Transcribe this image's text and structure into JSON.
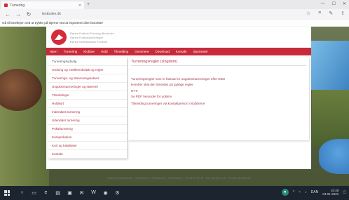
{
  "browser": {
    "tab_title": "Turnering",
    "tab_close": "✕",
    "new_tab": "+",
    "window_controls": [
      "—",
      "☐",
      "✕"
    ],
    "url": "testbulen.dk",
    "infobar_text": "Gå til fanelinjen ved at trykke på stjerne ved at importere dine favoritter"
  },
  "site": {
    "header_lines": [
      "Rønne Fodbold Forening Bornholm",
      "Rønne Fodboldturneringer",
      "Rønne Idrætsklubber Fodbold"
    ],
    "menu": [
      "Hjem",
      "Turnering",
      "Klubber",
      "Hold",
      "Tilmelding",
      "Dommere",
      "Download",
      "Kontakt",
      "Sponsorer"
    ]
  },
  "sidebar": {
    "items": [
      "Turneringsudvalg",
      "Ordning og medlemsbeløb og regler",
      "Turnerings- og stævneregulativer",
      "Ungdomsturneringer og stævner",
      "Tilmeldinger",
      "Holdkort",
      "Indendørs turnering",
      "Udendørs turnering",
      "Pokalturnering",
      "Kamprokation",
      "Kort og lokaliteter",
      "Kontakt"
    ]
  },
  "content": {
    "title": "Turneringsregler (Ungdom)",
    "lines": [
      "Turneringsregler som er fastsat for ungdomsturneringer efter DBU",
      "Herefter skal der tilmeldes på gyldige regler",
      "NYT:",
      "Se PDF herunder for udskriv",
      "Tilmelding turneringer via kontaktperson i klubberne"
    ]
  },
  "footer": "Dansk Fodbold Union · Idrætsvej 1 · Postboks 10 · 3700 Rønne · Tlf: 56 95 12 34 · Fax: 56 95 12 35 · E-mail: info@rff.dk",
  "taskbar": {
    "time": "10:49",
    "date": "04-01-2021",
    "lang": "DAN"
  }
}
